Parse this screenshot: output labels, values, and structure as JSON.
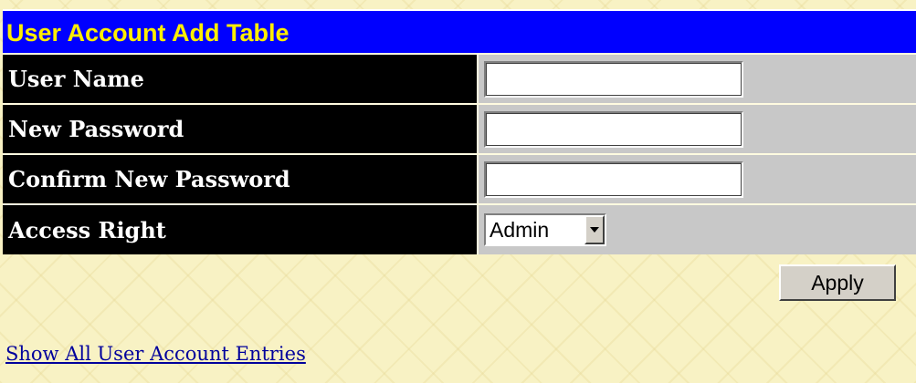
{
  "table": {
    "title": "User Account Add Table",
    "rows": [
      {
        "label": "User Name",
        "value": ""
      },
      {
        "label": "New Password",
        "value": ""
      },
      {
        "label": "Confirm New Password",
        "value": ""
      },
      {
        "label": "Access Right",
        "selected": "Admin"
      }
    ]
  },
  "actions": {
    "apply_label": "Apply"
  },
  "links": {
    "show_all": "Show All User Account Entries"
  },
  "colors": {
    "title_bg": "#0000ff",
    "title_text": "#ffee00",
    "label_bg": "#000000",
    "field_bg": "#c8c8c8",
    "page_bg": "#f8f2c4",
    "link": "#00009c"
  },
  "icons": {
    "select_arrow": "chevron-down-icon"
  }
}
